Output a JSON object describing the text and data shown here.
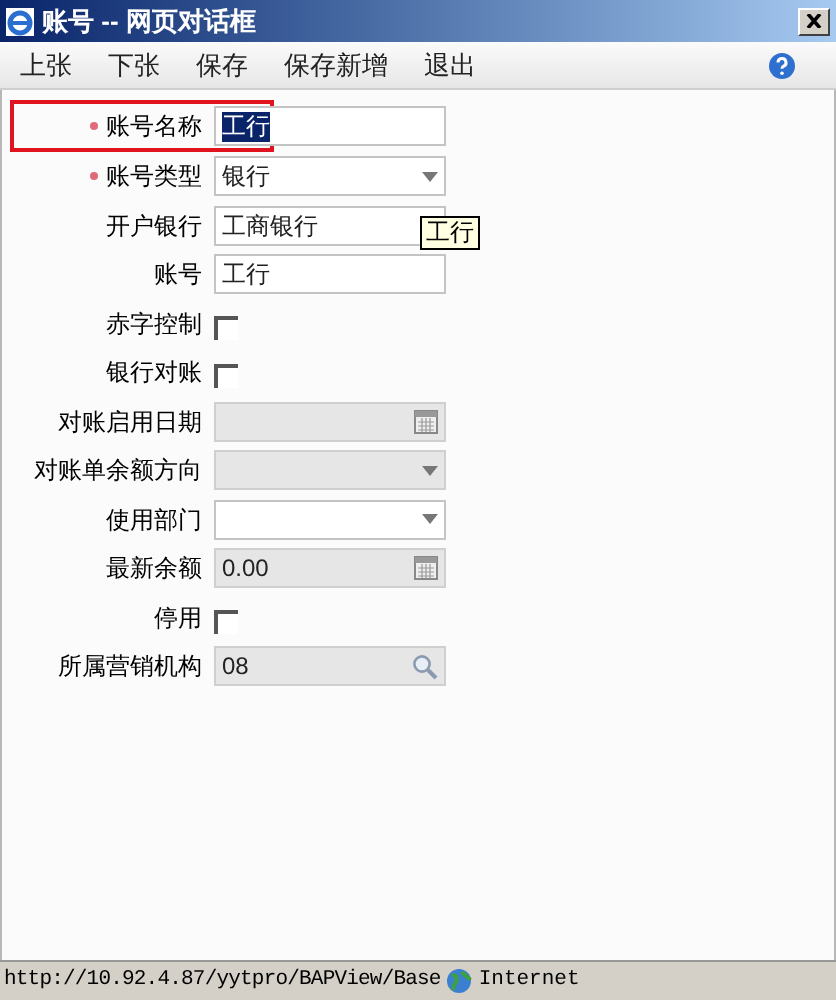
{
  "window": {
    "title": "账号 -- 网页对话框"
  },
  "toolbar": [
    "上张",
    "下张",
    "保存",
    "保存新增",
    "退出"
  ],
  "fields": [
    {
      "kind": "text",
      "label": "账号名称",
      "value": "工行",
      "required": true,
      "highlighted": true,
      "text_selected": true,
      "disabled": false
    },
    {
      "kind": "select",
      "label": "账号类型",
      "value": "银行",
      "required": true,
      "highlighted": false,
      "disabled": false
    },
    {
      "kind": "select",
      "label": "开户银行",
      "value": "工商银行",
      "required": false,
      "highlighted": false,
      "disabled": false
    },
    {
      "kind": "text",
      "label": "账号",
      "value": "工行",
      "required": false,
      "highlighted": false,
      "text_selected": false,
      "disabled": false
    },
    {
      "kind": "checkbox",
      "label": "赤字控制",
      "checked": false
    },
    {
      "kind": "checkbox",
      "label": "银行对账",
      "checked": false
    },
    {
      "kind": "date",
      "label": "对账启用日期",
      "required": false,
      "highlighted": false,
      "disabled": true
    },
    {
      "kind": "select",
      "label": "对账单余额方向",
      "required": false,
      "highlighted": false,
      "disabled": true
    },
    {
      "kind": "select",
      "label": "使用部门",
      "required": false,
      "highlighted": false,
      "disabled": false
    },
    {
      "kind": "date",
      "label": "最新余额",
      "value": "0.00",
      "required": false,
      "highlighted": false,
      "disabled": true
    },
    {
      "kind": "checkbox",
      "label": "停用",
      "checked": false
    },
    {
      "kind": "lookup",
      "label": "所属营销机构",
      "value": "08",
      "required": false,
      "highlighted": false,
      "disabled": true
    }
  ],
  "tooltip": "工行",
  "status_bar": {
    "url": "http://10.92.4.87/yytpro/BAPView/Base",
    "zone": "Internet"
  }
}
